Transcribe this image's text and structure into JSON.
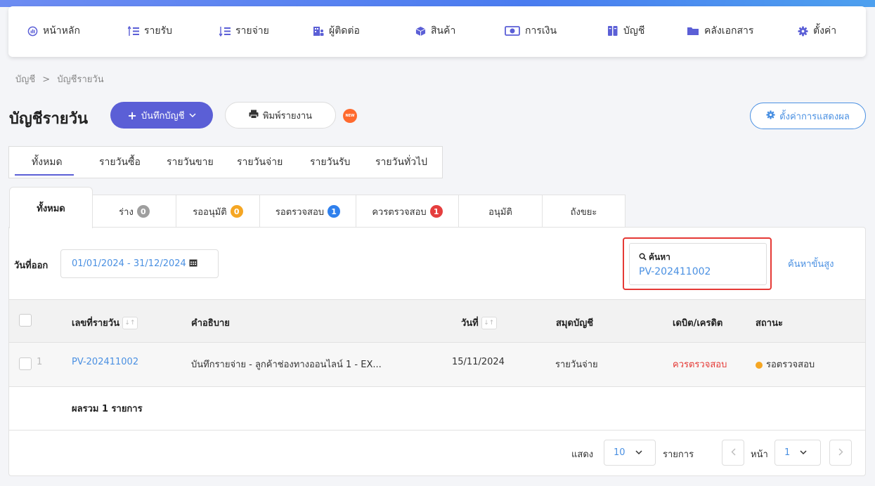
{
  "nav": {
    "items": [
      {
        "label": "หน้าหลัก",
        "icon": "dashboard-icon"
      },
      {
        "label": "รายรับ",
        "icon": "income-icon"
      },
      {
        "label": "รายจ่าย",
        "icon": "expense-icon"
      },
      {
        "label": "ผู้ติดต่อ",
        "icon": "contacts-icon"
      },
      {
        "label": "สินค้า",
        "icon": "box-icon"
      },
      {
        "label": "การเงิน",
        "icon": "money-icon"
      },
      {
        "label": "บัญชี",
        "icon": "ledger-icon"
      },
      {
        "label": "คลังเอกสาร",
        "icon": "folder-icon"
      },
      {
        "label": "ตั้งค่า",
        "icon": "gear-icon"
      }
    ]
  },
  "breadcrumb": {
    "parent": "บัญชี",
    "separator": ">",
    "current": "บัญชีรายวัน"
  },
  "page": {
    "title": "บัญชีรายวัน",
    "add_button": "บันทึกบัญชี",
    "print_button": "พิมพ์รายงาน",
    "new_badge": "NEW",
    "display_settings": "ตั้งค่าการแสดงผล"
  },
  "type_tabs": [
    "ทั้งหมด",
    "รายวันซื้อ",
    "รายวันขาย",
    "รายวันจ่าย",
    "รายวันรับ",
    "รายวันทั่วไป"
  ],
  "status_tabs": [
    {
      "label": "ทั้งหมด"
    },
    {
      "label": "ร่าง",
      "count": "0",
      "color": "#9e9e9e"
    },
    {
      "label": "รออนุมัติ",
      "count": "0",
      "color": "#f5a623"
    },
    {
      "label": "รอตรวจสอบ",
      "count": "1",
      "color": "#2f80ed"
    },
    {
      "label": "ควรตรวจสอบ",
      "count": "1",
      "color": "#e53e3e"
    },
    {
      "label": "อนุมัติ"
    },
    {
      "label": "ถังขยะ"
    }
  ],
  "filter": {
    "date_label": "วันที่ออก",
    "date_range": "01/01/2024 - 31/12/2024",
    "search_label": "ค้นหา",
    "search_value": "PV-202411002",
    "advanced_search": "ค้นหาขั้นสูง"
  },
  "table": {
    "headers": [
      "เลขที่รายวัน",
      "คำอธิบาย",
      "วันที่",
      "สมุดบัญชี",
      "เดบิต/เครดิต",
      "สถานะ"
    ],
    "rows": [
      {
        "index": "1",
        "doc_no": "PV-202411002",
        "description": "บันทึกรายจ่าย - ลูกค้าช่องทางออนไลน์ 1 - EX...",
        "date": "15/11/2024",
        "book": "รายวันจ่าย",
        "debit_credit": "ควรตรวจสอบ",
        "status": "รอตรวจสอบ"
      }
    ],
    "total": "ผลรวม 1 รายการ"
  },
  "pagination": {
    "show_label": "แสดง",
    "page_size": "10",
    "items_label": "รายการ",
    "page_label": "หน้า",
    "page": "1"
  },
  "colors": {
    "primary": "#5b5fd6",
    "link": "#4a90e2",
    "danger": "#e53935",
    "warning": "#f5a623"
  }
}
